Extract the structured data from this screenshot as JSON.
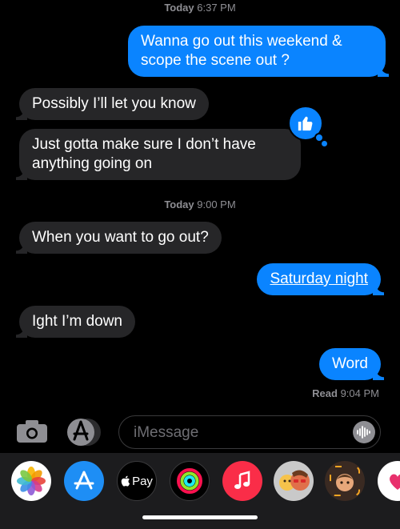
{
  "conversation": {
    "timestamp1": {
      "day": "Today",
      "time": "6:37 PM"
    },
    "timestamp2": {
      "day": "Today",
      "time": "9:00 PM"
    },
    "messages": [
      {
        "text": "Wanna go out this weekend & scope the scene out ?",
        "line1": "Wanna go out this weekend &",
        "line2": "scope the scene out ?",
        "direction": "outgoing"
      },
      {
        "text": "Possibly I’ll let you know",
        "direction": "incoming"
      },
      {
        "text": "Just gotta make sure I don’t have anything going on",
        "line1": "Just gotta make sure I don’t have",
        "line2": "anything going on",
        "direction": "incoming"
      },
      {
        "text": "When you want to go out?",
        "direction": "incoming"
      },
      {
        "text": "Saturday night",
        "direction": "outgoing"
      },
      {
        "text": "Ight I’m down",
        "direction": "incoming"
      },
      {
        "text": "Word",
        "direction": "outgoing"
      }
    ],
    "receipt": {
      "label": "Read",
      "time": "9:04 PM"
    },
    "tapback": {
      "icon": "thumbs-up-icon"
    }
  },
  "composer": {
    "placeholder": "iMessage",
    "camera_icon": "camera-icon",
    "apps_icon": "app-store-icon",
    "audio_icon": "audio-waveform-icon"
  },
  "app_drawer": {
    "apps": [
      {
        "name": "Photos",
        "icon": "photos-icon"
      },
      {
        "name": "App Store",
        "icon": "app-store-icon"
      },
      {
        "name": "Apple Pay",
        "label": "Pay",
        "icon": "apple-pay-icon"
      },
      {
        "name": "Activity",
        "icon": "activity-rings-icon"
      },
      {
        "name": "Music",
        "icon": "music-note-icon"
      },
      {
        "name": "Memoji Stickers",
        "icon": "memoji-stickers-icon"
      },
      {
        "name": "Memoji",
        "icon": "memoji-icon"
      },
      {
        "name": "Digital Touch",
        "icon": "digital-touch-icon"
      }
    ]
  },
  "colors": {
    "outgoing_bubble": "#0a84ff",
    "incoming_bubble": "#262628",
    "background": "#000000",
    "meta_text": "#8e8e93"
  }
}
